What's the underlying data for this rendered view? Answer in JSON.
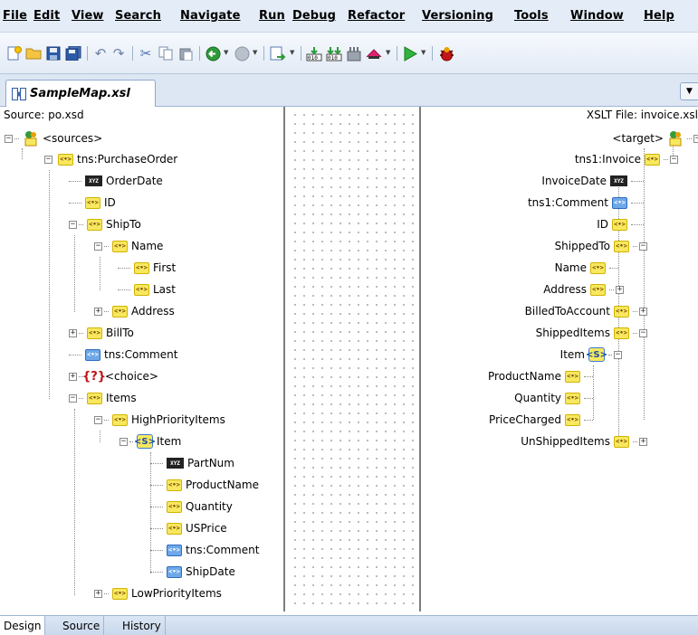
{
  "menubar": {
    "items": [
      "File",
      "Edit",
      "View",
      "Search",
      "Navigate",
      "Run",
      "Debug",
      "Refactor",
      "Versioning",
      "Tools",
      "Window",
      "Help"
    ]
  },
  "toolbar": {
    "buttons": [
      {
        "icon": "new-gallery-icon"
      },
      {
        "icon": "open-folder-icon"
      },
      {
        "icon": "save-icon"
      },
      {
        "icon": "save-all-icon"
      },
      {
        "icon": "undo-icon"
      },
      {
        "icon": "redo-icon"
      },
      {
        "icon": "cut-icon"
      },
      {
        "icon": "copy-icon"
      },
      {
        "icon": "paste-icon"
      },
      {
        "icon": "back-icon"
      },
      {
        "icon": "forward-icon"
      },
      {
        "icon": "navigate-icon"
      },
      {
        "icon": "make-icon"
      },
      {
        "icon": "rebuild-icon"
      },
      {
        "icon": "clean-icon"
      },
      {
        "icon": "deploy-icon"
      },
      {
        "icon": "run-icon"
      },
      {
        "icon": "debug-icon"
      }
    ]
  },
  "editor": {
    "tab_label": "SampleMap.xsl",
    "source_header": "Source: po.xsd",
    "target_header": "XSLT File: invoice.xsl"
  },
  "source_tree": [
    "<sources>",
    "tns:PurchaseOrder",
    "OrderDate",
    "ID",
    "ShipTo",
    "Name",
    "First",
    "Last",
    "Address",
    "BillTo",
    "tns:Comment",
    "<choice>",
    "Items",
    "HighPriorityItems",
    "Item",
    "PartNum",
    "ProductName",
    "Quantity",
    "USPrice",
    "tns:Comment",
    "ShipDate",
    "LowPriorityItems"
  ],
  "target_tree": [
    "<target>",
    "tns1:Invoice",
    "InvoiceDate",
    "tns1:Comment",
    "ID",
    "ShippedTo",
    "Name",
    "Address",
    "BilledToAccount",
    "ShippedItems",
    "Item",
    "ProductName",
    "Quantity",
    "PriceCharged",
    "UnShippedItems"
  ],
  "bottom_tabs": [
    "Design",
    "Source",
    "History"
  ],
  "colors": {
    "accent": "#dde7f4",
    "tag_yellow": "#f7e85f",
    "choice_red": "#c01010"
  }
}
